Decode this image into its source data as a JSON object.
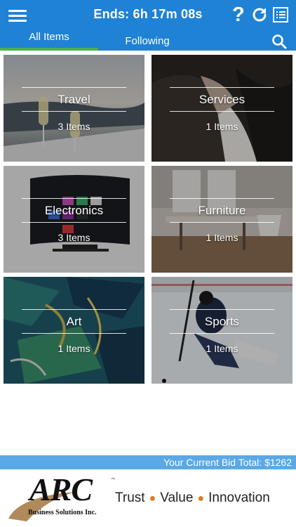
{
  "header": {
    "timer_text": "Ends: 6h 17m 08s",
    "help_label": "?"
  },
  "tabs": [
    {
      "label": "All Items",
      "active": true
    },
    {
      "label": "Following",
      "active": false
    }
  ],
  "categories": [
    {
      "title": "Travel",
      "count": "3 Items"
    },
    {
      "title": "Services",
      "count": "1 Items"
    },
    {
      "title": "Electronics",
      "count": "3 Items"
    },
    {
      "title": "Furniture",
      "count": "1 Items"
    },
    {
      "title": "Art",
      "count": "1 Items"
    },
    {
      "title": "Sports",
      "count": "1 Items"
    }
  ],
  "bid_total": "Your Current Bid Total: $1262",
  "footer": {
    "logo_text": "ARC",
    "logo_tm": "™",
    "logo_subtitle": "Business Solutions Inc.",
    "tagline": [
      "Trust",
      "Value",
      "Innovation"
    ]
  },
  "colors": {
    "header_bg": "#1f82d4",
    "tab_underline": "#4caf50",
    "bid_bar": "#5aa9e6",
    "tagline_dot": "#e07a1f"
  },
  "icons": [
    "hamburger-menu-icon",
    "help-icon",
    "refresh-icon",
    "list-icon",
    "search-icon"
  ]
}
